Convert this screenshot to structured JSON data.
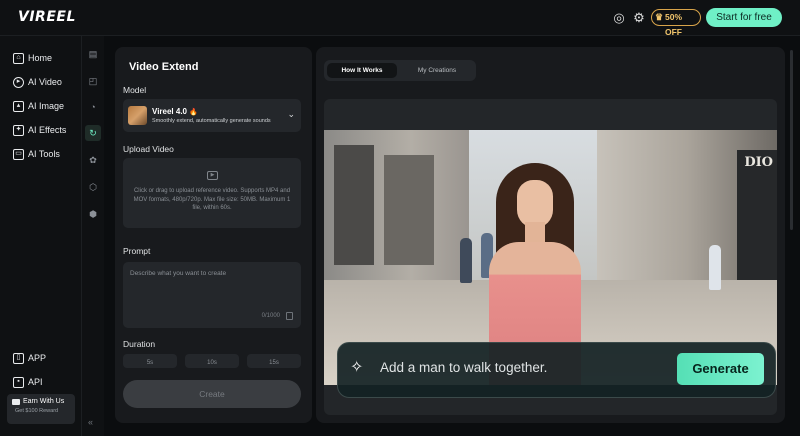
{
  "header": {
    "logo": "VIREEL",
    "support_icon": "headset-icon",
    "settings_icon": "gear-icon",
    "promo_badge": "50% OFF",
    "start_label": "Start for free"
  },
  "sidebar": {
    "items": [
      {
        "label": "Home",
        "icon": "home-icon"
      },
      {
        "label": "AI Video",
        "icon": "play-icon"
      },
      {
        "label": "AI Image",
        "icon": "image-icon"
      },
      {
        "label": "AI Effects",
        "icon": "effects-icon"
      },
      {
        "label": "AI Tools",
        "icon": "toolbox-icon"
      }
    ],
    "bottom_items": [
      {
        "label": "APP",
        "icon": "phone-icon"
      },
      {
        "label": "API",
        "icon": "api-icon"
      }
    ],
    "earn": {
      "title": "Earn With Us",
      "subtitle": "Get $100 Reward"
    }
  },
  "panel": {
    "title": "Video Extend",
    "model_label": "Model",
    "model_name": "Vireel 4.0",
    "model_desc": "Smoothly extend, automatically generate sounds",
    "upload_label": "Upload Video",
    "upload_text": "Click or drag to upload reference video. Supports MP4 and MOV formats, 480p/720p. Max file size: 50MB. Maximum 1 file, within 60s.",
    "prompt_label": "Prompt",
    "prompt_placeholder": "Describe what you want to create",
    "prompt_count": "0/1000",
    "duration_label": "Duration",
    "durations": [
      "5s",
      "10s",
      "15s"
    ],
    "create_label": "Create"
  },
  "main": {
    "tabs": [
      {
        "label": "How It Works",
        "active": true
      },
      {
        "label": "My Creations",
        "active": false
      }
    ],
    "preview": {
      "prompt_text": "Add a man to walk together.",
      "generate_label": "Generate",
      "store_sign": "DIO"
    }
  },
  "colors": {
    "accent": "#6ff0c6",
    "background": "#0b0d0f",
    "panel": "#181a1d",
    "promo": "#f1c56c"
  }
}
